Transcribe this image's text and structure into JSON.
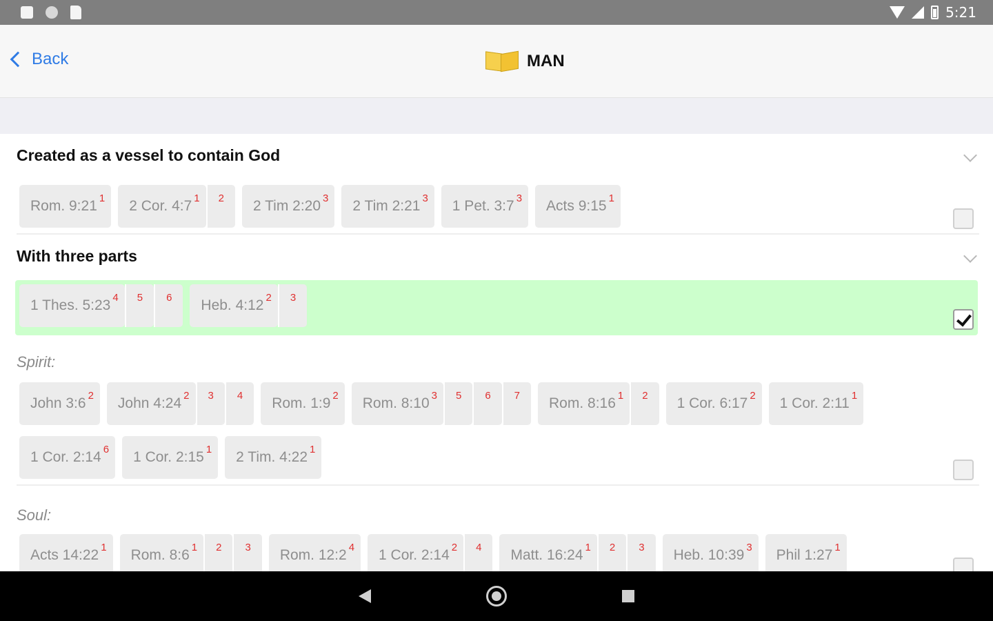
{
  "status_bar": {
    "time": "5:21"
  },
  "nav": {
    "back_label": "Back",
    "title": "MAN"
  },
  "sections": {
    "s1": {
      "title": "Created as a vessel to contain God",
      "chips": [
        {
          "ref": "Rom. 9:21",
          "sup": "1"
        },
        {
          "ref": "2 Cor. 4:7",
          "sup": "1",
          "extra": "2"
        },
        {
          "ref": "2 Tim 2:20",
          "sup": "3"
        },
        {
          "ref": "2 Tim 2:21",
          "sup": "3"
        },
        {
          "ref": "1 Pet. 3:7",
          "sup": "3"
        },
        {
          "ref": "Acts 9:15",
          "sup": "1"
        }
      ]
    },
    "s2": {
      "title": "With three parts",
      "chips": [
        {
          "ref": "1 Thes. 5:23",
          "sup": "4",
          "extra1": "5",
          "extra2": "6"
        },
        {
          "ref": "Heb. 4:12",
          "sup": "2",
          "extra": "3"
        }
      ]
    },
    "spirit": {
      "label": "Spirit:",
      "row1": [
        {
          "ref": "John 3:6",
          "sup": "2"
        },
        {
          "ref": "John 4:24",
          "sup": "2",
          "extra1": "3",
          "extra2": "4"
        },
        {
          "ref": "Rom. 1:9",
          "sup": "2"
        },
        {
          "ref": "Rom. 8:10",
          "sup": "3",
          "extra1": "5",
          "extra2": "6",
          "extra3": "7"
        },
        {
          "ref": "Rom. 8:16",
          "sup": "1",
          "extra": "2"
        },
        {
          "ref": "1 Cor. 6:17",
          "sup": "2"
        },
        {
          "ref": "1 Cor. 2:11",
          "sup": "1"
        }
      ],
      "row2": [
        {
          "ref": "1 Cor. 2:14",
          "sup": "6"
        },
        {
          "ref": "1 Cor. 2:15",
          "sup": "1"
        },
        {
          "ref": "2 Tim. 4:22",
          "sup": "1"
        }
      ]
    },
    "soul": {
      "label": "Soul:",
      "row1": [
        {
          "ref": "Acts 14:22",
          "sup": "1"
        },
        {
          "ref": "Rom. 8:6",
          "sup": "1",
          "extra1": "2",
          "extra2": "3"
        },
        {
          "ref": "Rom. 12:2",
          "sup": "4"
        },
        {
          "ref": "1 Cor. 2:14",
          "sup": "2",
          "extra": "4"
        },
        {
          "ref": "Matt. 16:24",
          "sup": "1",
          "extra1": "2",
          "extra2": "3"
        },
        {
          "ref": "Heb. 10:39",
          "sup": "3"
        },
        {
          "ref": "Phil 1:27",
          "sup": "1"
        }
      ]
    }
  }
}
